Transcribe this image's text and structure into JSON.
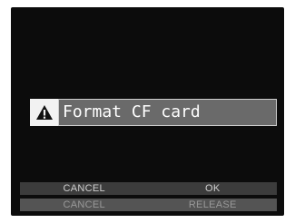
{
  "dialog": {
    "message": "Format CF card",
    "icon": "warning-icon"
  },
  "buttons": {
    "primary": {
      "cancel": "CANCEL",
      "ok": "OK"
    },
    "secondary": {
      "cancel": "CANCEL",
      "release": "RELEASE"
    }
  },
  "colors": {
    "screen_bg": "#0c0c0c",
    "message_bg": "#6a6a6a",
    "message_border": "#cfcfcf",
    "warning_bg": "#f2f2f2",
    "bar_top": "#3c3c3c",
    "bar_bottom": "#545454"
  }
}
